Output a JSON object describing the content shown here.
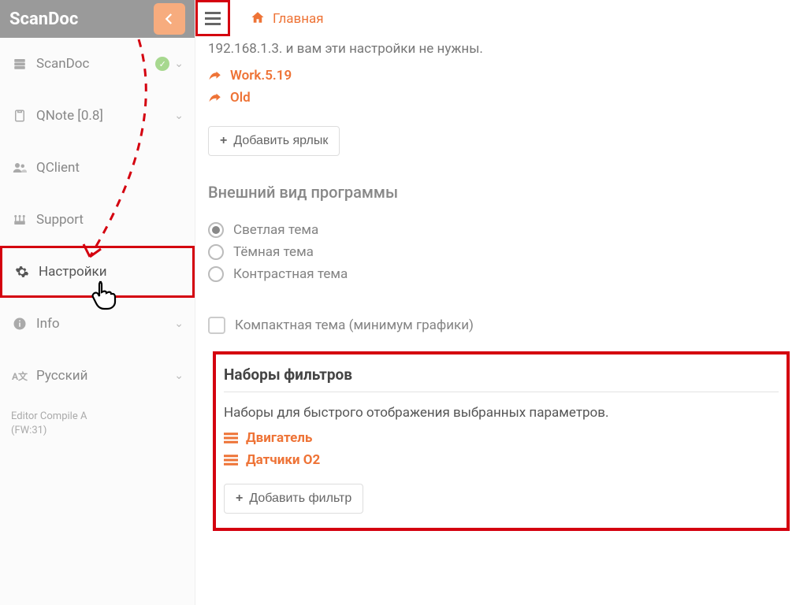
{
  "app": {
    "title": "ScanDoc"
  },
  "sidebar": {
    "items": [
      {
        "label": "ScanDoc"
      },
      {
        "label": "QNote [0.8]"
      },
      {
        "label": "QClient"
      },
      {
        "label": "Support"
      },
      {
        "label": "Настройки"
      },
      {
        "label": "Info"
      },
      {
        "label": "Русский"
      }
    ],
    "footer1": "Editor Compile A",
    "footer2": "(FW:31)"
  },
  "breadcrumb": {
    "home": "Главная"
  },
  "ip_text": "192.168.1.3. и вам эти настройки не нужны.",
  "shortcuts": [
    {
      "label": "Work.5.19"
    },
    {
      "label": "Old"
    }
  ],
  "add_shortcut": "Добавить ярлык",
  "appearance": {
    "title": "Внешний вид программы",
    "themes": [
      {
        "label": "Светлая тема",
        "selected": true
      },
      {
        "label": "Тёмная тема",
        "selected": false
      },
      {
        "label": "Контрастная тема",
        "selected": false
      }
    ],
    "compact": "Компактная тема (минимум графики)"
  },
  "filters": {
    "title": "Наборы фильтров",
    "desc": "Наборы для быстрого отображения выбранных параметров.",
    "items": [
      {
        "label": "Двигатель"
      },
      {
        "label": "Датчики О2"
      }
    ],
    "add": "Добавить фильтр"
  }
}
